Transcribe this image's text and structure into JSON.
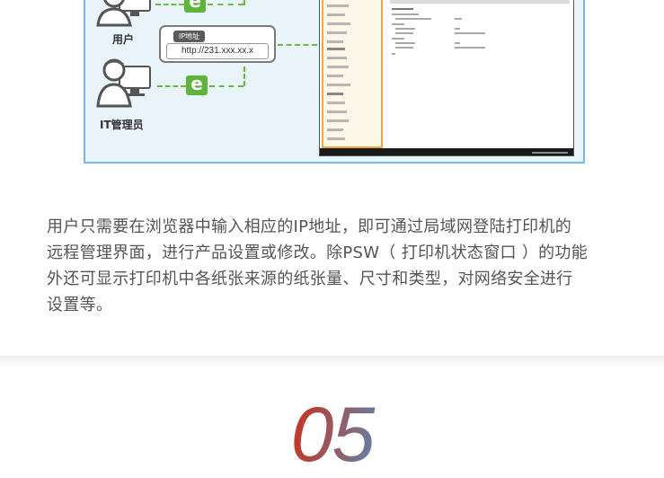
{
  "illustration": {
    "user_label": "用户",
    "it_admin_label": "IT管理员",
    "ip_tag": "IP地址",
    "ip_url": "http://231.xxx.xx.x",
    "browser_icon_glyph": "e",
    "icons": [
      "user-person-icon",
      "it-admin-person-icon",
      "browser-e-icon",
      "monitor-icon"
    ],
    "colors": {
      "frame": "#7ab8df",
      "background": "#e9f4fb",
      "connector": "#6dbb46",
      "browser_icon": "#5fb43b",
      "sidebar_accent": "#f1a53d"
    }
  },
  "description": {
    "line1": "用户只需要在浏览器中输入相应的IP地址，即可通过局域网登陆打印机的",
    "line2": "远程管理界面，进行产品设置或修改。除PSW（ 打印机状态窗口 ）的功能",
    "line3": "外还可显示打印机中各纸张来源的纸张量、尺寸和类型，对网络安全进行",
    "line4": "设置等。"
  },
  "section": {
    "number": "05"
  }
}
